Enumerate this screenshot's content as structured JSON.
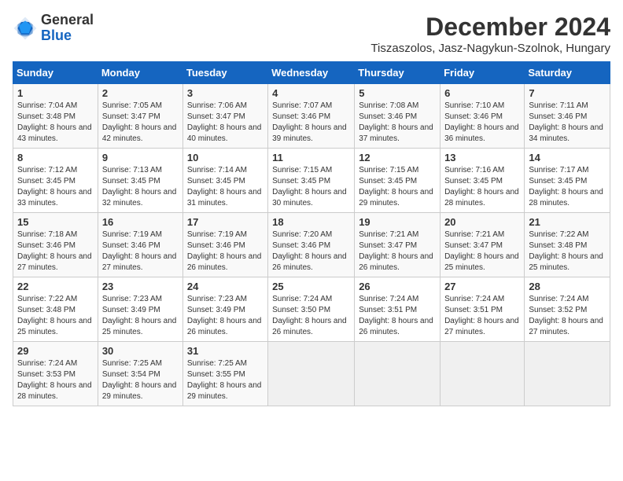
{
  "logo": {
    "general": "General",
    "blue": "Blue"
  },
  "title": {
    "month": "December 2024",
    "location": "Tiszaszolos, Jasz-Nagykun-Szolnok, Hungary"
  },
  "weekdays": [
    "Sunday",
    "Monday",
    "Tuesday",
    "Wednesday",
    "Thursday",
    "Friday",
    "Saturday"
  ],
  "weeks": [
    [
      {
        "day": "1",
        "sunrise": "Sunrise: 7:04 AM",
        "sunset": "Sunset: 3:48 PM",
        "daylight": "Daylight: 8 hours and 43 minutes."
      },
      {
        "day": "2",
        "sunrise": "Sunrise: 7:05 AM",
        "sunset": "Sunset: 3:47 PM",
        "daylight": "Daylight: 8 hours and 42 minutes."
      },
      {
        "day": "3",
        "sunrise": "Sunrise: 7:06 AM",
        "sunset": "Sunset: 3:47 PM",
        "daylight": "Daylight: 8 hours and 40 minutes."
      },
      {
        "day": "4",
        "sunrise": "Sunrise: 7:07 AM",
        "sunset": "Sunset: 3:46 PM",
        "daylight": "Daylight: 8 hours and 39 minutes."
      },
      {
        "day": "5",
        "sunrise": "Sunrise: 7:08 AM",
        "sunset": "Sunset: 3:46 PM",
        "daylight": "Daylight: 8 hours and 37 minutes."
      },
      {
        "day": "6",
        "sunrise": "Sunrise: 7:10 AM",
        "sunset": "Sunset: 3:46 PM",
        "daylight": "Daylight: 8 hours and 36 minutes."
      },
      {
        "day": "7",
        "sunrise": "Sunrise: 7:11 AM",
        "sunset": "Sunset: 3:46 PM",
        "daylight": "Daylight: 8 hours and 34 minutes."
      }
    ],
    [
      {
        "day": "8",
        "sunrise": "Sunrise: 7:12 AM",
        "sunset": "Sunset: 3:45 PM",
        "daylight": "Daylight: 8 hours and 33 minutes."
      },
      {
        "day": "9",
        "sunrise": "Sunrise: 7:13 AM",
        "sunset": "Sunset: 3:45 PM",
        "daylight": "Daylight: 8 hours and 32 minutes."
      },
      {
        "day": "10",
        "sunrise": "Sunrise: 7:14 AM",
        "sunset": "Sunset: 3:45 PM",
        "daylight": "Daylight: 8 hours and 31 minutes."
      },
      {
        "day": "11",
        "sunrise": "Sunrise: 7:15 AM",
        "sunset": "Sunset: 3:45 PM",
        "daylight": "Daylight: 8 hours and 30 minutes."
      },
      {
        "day": "12",
        "sunrise": "Sunrise: 7:15 AM",
        "sunset": "Sunset: 3:45 PM",
        "daylight": "Daylight: 8 hours and 29 minutes."
      },
      {
        "day": "13",
        "sunrise": "Sunrise: 7:16 AM",
        "sunset": "Sunset: 3:45 PM",
        "daylight": "Daylight: 8 hours and 28 minutes."
      },
      {
        "day": "14",
        "sunrise": "Sunrise: 7:17 AM",
        "sunset": "Sunset: 3:45 PM",
        "daylight": "Daylight: 8 hours and 28 minutes."
      }
    ],
    [
      {
        "day": "15",
        "sunrise": "Sunrise: 7:18 AM",
        "sunset": "Sunset: 3:46 PM",
        "daylight": "Daylight: 8 hours and 27 minutes."
      },
      {
        "day": "16",
        "sunrise": "Sunrise: 7:19 AM",
        "sunset": "Sunset: 3:46 PM",
        "daylight": "Daylight: 8 hours and 27 minutes."
      },
      {
        "day": "17",
        "sunrise": "Sunrise: 7:19 AM",
        "sunset": "Sunset: 3:46 PM",
        "daylight": "Daylight: 8 hours and 26 minutes."
      },
      {
        "day": "18",
        "sunrise": "Sunrise: 7:20 AM",
        "sunset": "Sunset: 3:46 PM",
        "daylight": "Daylight: 8 hours and 26 minutes."
      },
      {
        "day": "19",
        "sunrise": "Sunrise: 7:21 AM",
        "sunset": "Sunset: 3:47 PM",
        "daylight": "Daylight: 8 hours and 26 minutes."
      },
      {
        "day": "20",
        "sunrise": "Sunrise: 7:21 AM",
        "sunset": "Sunset: 3:47 PM",
        "daylight": "Daylight: 8 hours and 25 minutes."
      },
      {
        "day": "21",
        "sunrise": "Sunrise: 7:22 AM",
        "sunset": "Sunset: 3:48 PM",
        "daylight": "Daylight: 8 hours and 25 minutes."
      }
    ],
    [
      {
        "day": "22",
        "sunrise": "Sunrise: 7:22 AM",
        "sunset": "Sunset: 3:48 PM",
        "daylight": "Daylight: 8 hours and 25 minutes."
      },
      {
        "day": "23",
        "sunrise": "Sunrise: 7:23 AM",
        "sunset": "Sunset: 3:49 PM",
        "daylight": "Daylight: 8 hours and 25 minutes."
      },
      {
        "day": "24",
        "sunrise": "Sunrise: 7:23 AM",
        "sunset": "Sunset: 3:49 PM",
        "daylight": "Daylight: 8 hours and 26 minutes."
      },
      {
        "day": "25",
        "sunrise": "Sunrise: 7:24 AM",
        "sunset": "Sunset: 3:50 PM",
        "daylight": "Daylight: 8 hours and 26 minutes."
      },
      {
        "day": "26",
        "sunrise": "Sunrise: 7:24 AM",
        "sunset": "Sunset: 3:51 PM",
        "daylight": "Daylight: 8 hours and 26 minutes."
      },
      {
        "day": "27",
        "sunrise": "Sunrise: 7:24 AM",
        "sunset": "Sunset: 3:51 PM",
        "daylight": "Daylight: 8 hours and 27 minutes."
      },
      {
        "day": "28",
        "sunrise": "Sunrise: 7:24 AM",
        "sunset": "Sunset: 3:52 PM",
        "daylight": "Daylight: 8 hours and 27 minutes."
      }
    ],
    [
      {
        "day": "29",
        "sunrise": "Sunrise: 7:24 AM",
        "sunset": "Sunset: 3:53 PM",
        "daylight": "Daylight: 8 hours and 28 minutes."
      },
      {
        "day": "30",
        "sunrise": "Sunrise: 7:25 AM",
        "sunset": "Sunset: 3:54 PM",
        "daylight": "Daylight: 8 hours and 29 minutes."
      },
      {
        "day": "31",
        "sunrise": "Sunrise: 7:25 AM",
        "sunset": "Sunset: 3:55 PM",
        "daylight": "Daylight: 8 hours and 29 minutes."
      },
      null,
      null,
      null,
      null
    ]
  ]
}
